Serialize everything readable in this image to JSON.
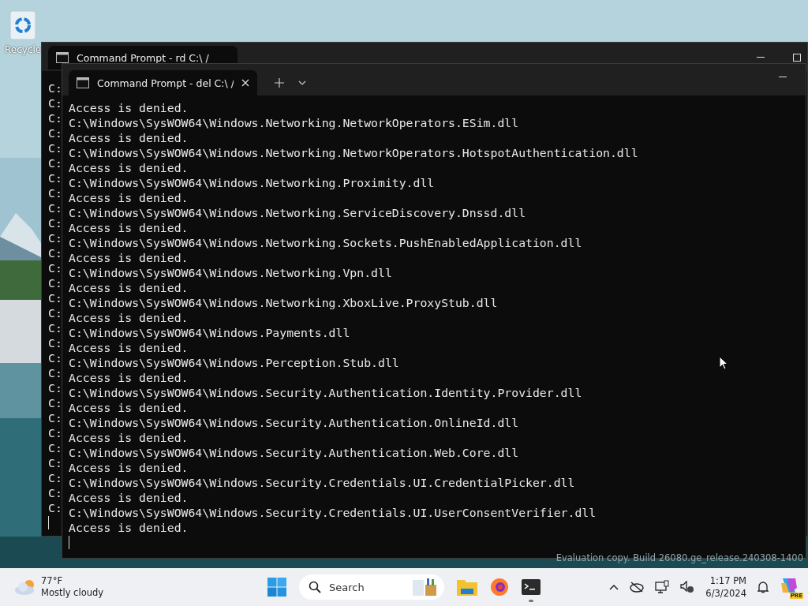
{
  "desktop_icons": [
    {
      "label": "Recycle"
    }
  ],
  "back_window": {
    "tab_title": "Command Prompt - rd  C:\\ /",
    "lines": [
      "C:",
      "C:",
      "C:",
      "C:",
      "C:",
      "C:",
      "C:",
      "C:",
      "C:",
      "C:",
      "C:",
      "C:",
      "C:",
      "C:",
      "C:",
      "C:",
      "C:",
      "C:",
      "C:",
      "C:",
      "C:",
      "C:",
      "C:",
      "C:",
      "C:",
      "C:",
      "C:",
      "C:",
      "C:"
    ]
  },
  "front_window": {
    "tab_title": "Command Prompt - del  C:\\ /",
    "lines": [
      "Access is denied.",
      "C:\\Windows\\SysWOW64\\Windows.Networking.NetworkOperators.ESim.dll",
      "Access is denied.",
      "C:\\Windows\\SysWOW64\\Windows.Networking.NetworkOperators.HotspotAuthentication.dll",
      "Access is denied.",
      "C:\\Windows\\SysWOW64\\Windows.Networking.Proximity.dll",
      "Access is denied.",
      "C:\\Windows\\SysWOW64\\Windows.Networking.ServiceDiscovery.Dnssd.dll",
      "Access is denied.",
      "C:\\Windows\\SysWOW64\\Windows.Networking.Sockets.PushEnabledApplication.dll",
      "Access is denied.",
      "C:\\Windows\\SysWOW64\\Windows.Networking.Vpn.dll",
      "Access is denied.",
      "C:\\Windows\\SysWOW64\\Windows.Networking.XboxLive.ProxyStub.dll",
      "Access is denied.",
      "C:\\Windows\\SysWOW64\\Windows.Payments.dll",
      "Access is denied.",
      "C:\\Windows\\SysWOW64\\Windows.Perception.Stub.dll",
      "Access is denied.",
      "C:\\Windows\\SysWOW64\\Windows.Security.Authentication.Identity.Provider.dll",
      "Access is denied.",
      "C:\\Windows\\SysWOW64\\Windows.Security.Authentication.OnlineId.dll",
      "Access is denied.",
      "C:\\Windows\\SysWOW64\\Windows.Security.Authentication.Web.Core.dll",
      "Access is denied.",
      "C:\\Windows\\SysWOW64\\Windows.Security.Credentials.UI.CredentialPicker.dll",
      "Access is denied.",
      "C:\\Windows\\SysWOW64\\Windows.Security.Credentials.UI.UserConsentVerifier.dll",
      "Access is denied."
    ]
  },
  "build_info": "Evaluation copy. Build 26080.ge_release.240308-1400",
  "taskbar": {
    "weather": {
      "temperature": "77°F",
      "condition": "Mostly cloudy"
    },
    "search": {
      "placeholder": "Search"
    },
    "clock": {
      "time": "1:17 PM",
      "date": "6/3/2024"
    },
    "copilot_badge": "PRE"
  }
}
